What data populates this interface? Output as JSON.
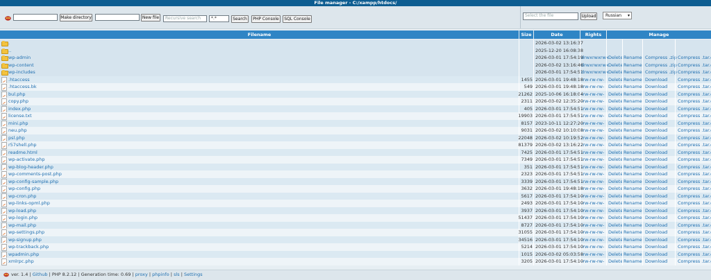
{
  "title": "File manager - C:/xampp/htdocs/",
  "toolbar": {
    "make_dir_value": "",
    "make_dir_label": "Make directory",
    "new_file_value": "",
    "new_file_label": "New file",
    "search_placeholder": "Recursive search",
    "mask_value": "*.*",
    "search_label": "Search",
    "php_console_label": "PHP Console",
    "sql_console_label": "SQL Console",
    "select_file_placeholder": "Select the file",
    "upload_label": "Upload",
    "language": "Russian"
  },
  "columns": {
    "filename": "Filename",
    "size": "Size",
    "date": "Date",
    "rights": "Rights",
    "manage": "Manage"
  },
  "rows": [
    {
      "type": "dir",
      "name": ".",
      "size": "",
      "date": "2026-03-02 13:16:37",
      "rights": "",
      "del": "",
      "ren": "",
      "dl": "",
      "cg": ""
    },
    {
      "type": "dir",
      "name": "..",
      "size": "",
      "date": "2025-12-20 16:08:38",
      "rights": "",
      "del": "",
      "ren": "",
      "dl": "",
      "cg": ""
    },
    {
      "type": "dir",
      "name": "wp-admin",
      "size": "",
      "date": "2026-03-01 17:54:19",
      "rights": "drwxrwxrwx",
      "del": "Delete",
      "ren": "Rename",
      "dl": "Compress .zip",
      "cg": "Compress .tar.gz"
    },
    {
      "type": "dir",
      "name": "wp-content",
      "size": "",
      "date": "2026-03-02 13:16:46",
      "rights": "drwxrwxrwx",
      "del": "Delete",
      "ren": "Rename",
      "dl": "Compress .zip",
      "cg": "Compress .tar.gz"
    },
    {
      "type": "dir",
      "name": "wp-includes",
      "size": "",
      "date": "2026-03-01 17:54:51",
      "rights": "drwxrwxrwx",
      "del": "Delete",
      "ren": "Rename",
      "dl": "Compress .zip",
      "cg": "Compress .tar.gz"
    },
    {
      "type": "file",
      "name": ".htaccess",
      "size": "1455",
      "date": "2026-03-01 19:48:18",
      "rights": "-rw-rw-rw-",
      "del": "Delete",
      "ren": "Rename",
      "dl": "Download",
      "cg": "Compress .tar.gz"
    },
    {
      "type": "file",
      "name": ".htaccess.bk",
      "size": "549",
      "date": "2026-03-01 19:48:18",
      "rights": "-rw-rw-rw-",
      "del": "Delete",
      "ren": "Rename",
      "dl": "Download",
      "cg": "Compress .tar.gz"
    },
    {
      "type": "file",
      "name": "bul.php",
      "size": "21262",
      "date": "2025-10-06 16:18:04",
      "rights": "-rw-rw-rw-",
      "del": "Delete",
      "ren": "Rename",
      "dl": "Download",
      "cg": "Compress .tar.gz"
    },
    {
      "type": "file",
      "name": "copy.php",
      "size": "2311",
      "date": "2026-03-02 12:35:20",
      "rights": "-rw-rw-rw-",
      "del": "Delete",
      "ren": "Rename",
      "dl": "Download",
      "cg": "Compress .tar.gz"
    },
    {
      "type": "file",
      "name": "index.php",
      "size": "405",
      "date": "2026-03-01 17:54:51",
      "rights": "-rw-rw-rw-",
      "del": "Delete",
      "ren": "Rename",
      "dl": "Download",
      "cg": "Compress .tar.gz"
    },
    {
      "type": "file",
      "name": "license.txt",
      "size": "19903",
      "date": "2026-03-01 17:54:51",
      "rights": "-rw-rw-rw-",
      "del": "Delete",
      "ren": "Rename",
      "dl": "Download",
      "cg": "Compress .tar.gz"
    },
    {
      "type": "file",
      "name": "mini.php",
      "size": "8157",
      "date": "2023-10-11 12:27:20",
      "rights": "-rw-rw-rw-",
      "del": "Delete",
      "ren": "Rename",
      "dl": "Download",
      "cg": "Compress .tar.gz"
    },
    {
      "type": "file",
      "name": "neu.php",
      "size": "9031",
      "date": "2026-03-02 10:10:08",
      "rights": "-rw-rw-rw-",
      "del": "Delete",
      "ren": "Rename",
      "dl": "Download",
      "cg": "Compress .tar.gz"
    },
    {
      "type": "file",
      "name": "psl.php",
      "size": "22048",
      "date": "2026-03-02 10:19:52",
      "rights": "-rw-rw-rw-",
      "del": "Delete",
      "ren": "Rename",
      "dl": "Download",
      "cg": "Compress .tar.gz"
    },
    {
      "type": "file",
      "name": "r57shell.php",
      "size": "81379",
      "date": "2026-03-02 13:16:22",
      "rights": "-rw-rw-rw-",
      "del": "Delete",
      "ren": "Rename",
      "dl": "Download",
      "cg": "Compress .tar.gz"
    },
    {
      "type": "file",
      "name": "readme.html",
      "size": "7425",
      "date": "2026-03-01 17:54:51",
      "rights": "-rw-rw-rw-",
      "del": "Delete",
      "ren": "Rename",
      "dl": "Download",
      "cg": "Compress .tar.gz"
    },
    {
      "type": "file",
      "name": "wp-activate.php",
      "size": "7349",
      "date": "2026-03-01 17:54:51",
      "rights": "-rw-rw-rw-",
      "del": "Delete",
      "ren": "Rename",
      "dl": "Download",
      "cg": "Compress .tar.gz"
    },
    {
      "type": "file",
      "name": "wp-blog-header.php",
      "size": "351",
      "date": "2026-03-01 17:54:51",
      "rights": "-rw-rw-rw-",
      "del": "Delete",
      "ren": "Rename",
      "dl": "Download",
      "cg": "Compress .tar.gz"
    },
    {
      "type": "file",
      "name": "wp-comments-post.php",
      "size": "2323",
      "date": "2026-03-01 17:54:51",
      "rights": "-rw-rw-rw-",
      "del": "Delete",
      "ren": "Rename",
      "dl": "Download",
      "cg": "Compress .tar.gz"
    },
    {
      "type": "file",
      "name": "wp-config-sample.php",
      "size": "3339",
      "date": "2026-03-01 17:54:51",
      "rights": "-rw-rw-rw-",
      "del": "Delete",
      "ren": "Rename",
      "dl": "Download",
      "cg": "Compress .tar.gz"
    },
    {
      "type": "file",
      "name": "wp-config.php",
      "size": "3632",
      "date": "2026-03-01 19:48:18",
      "rights": "-rw-rw-rw-",
      "del": "Delete",
      "ren": "Rename",
      "dl": "Download",
      "cg": "Compress .tar.gz"
    },
    {
      "type": "file",
      "name": "wp-cron.php",
      "size": "5617",
      "date": "2026-03-01 17:54:10",
      "rights": "-rw-rw-rw-",
      "del": "Delete",
      "ren": "Rename",
      "dl": "Download",
      "cg": "Compress .tar.gz"
    },
    {
      "type": "file",
      "name": "wp-links-opml.php",
      "size": "2493",
      "date": "2026-03-01 17:54:10",
      "rights": "-rw-rw-rw-",
      "del": "Delete",
      "ren": "Rename",
      "dl": "Download",
      "cg": "Compress .tar.gz"
    },
    {
      "type": "file",
      "name": "wp-load.php",
      "size": "3937",
      "date": "2026-03-01 17:54:10",
      "rights": "-rw-rw-rw-",
      "del": "Delete",
      "ren": "Rename",
      "dl": "Download",
      "cg": "Compress .tar.gz"
    },
    {
      "type": "file",
      "name": "wp-login.php",
      "size": "51437",
      "date": "2026-03-01 17:54:10",
      "rights": "-rw-rw-rw-",
      "del": "Delete",
      "ren": "Rename",
      "dl": "Download",
      "cg": "Compress .tar.gz"
    },
    {
      "type": "file",
      "name": "wp-mail.php",
      "size": "8727",
      "date": "2026-03-01 17:54:10",
      "rights": "-rw-rw-rw-",
      "del": "Delete",
      "ren": "Rename",
      "dl": "Download",
      "cg": "Compress .tar.gz"
    },
    {
      "type": "file",
      "name": "wp-settings.php",
      "size": "31055",
      "date": "2026-03-01 17:54:10",
      "rights": "-rw-rw-rw-",
      "del": "Delete",
      "ren": "Rename",
      "dl": "Download",
      "cg": "Compress .tar.gz"
    },
    {
      "type": "file",
      "name": "wp-signup.php",
      "size": "34516",
      "date": "2026-03-01 17:54:10",
      "rights": "-rw-rw-rw-",
      "del": "Delete",
      "ren": "Rename",
      "dl": "Download",
      "cg": "Compress .tar.gz"
    },
    {
      "type": "file",
      "name": "wp-trackback.php",
      "size": "5214",
      "date": "2026-03-01 17:54:10",
      "rights": "-rw-rw-rw-",
      "del": "Delete",
      "ren": "Rename",
      "dl": "Download",
      "cg": "Compress .tar.gz"
    },
    {
      "type": "file",
      "name": "wpadmin.php",
      "size": "1015",
      "date": "2026-03-02 05:03:58",
      "rights": "-rw-rw-rw-",
      "del": "Delete",
      "ren": "Rename",
      "dl": "Download",
      "cg": "Compress .tar.gz"
    },
    {
      "type": "file",
      "name": "xmlrpc.php",
      "size": "3205",
      "date": "2026-03-01 17:54:10",
      "rights": "-rw-rw-rw-",
      "del": "Delete",
      "ren": "Rename",
      "dl": "Download",
      "cg": "Compress .tar.gz"
    }
  ],
  "footer": {
    "version": "ver. 1.4",
    "sep1": " | ",
    "github": "Github",
    "sep2": " | ",
    "php": "PHP 8.2.12",
    "sep3": " | ",
    "gen": "Generation time: 0.69",
    "sep4": " | ",
    "proxy": "proxy",
    "sep5": " | ",
    "phpinfo": "phpinfo",
    "sep6": " | ",
    "sls": "sls",
    "sep7": " | ",
    "settings": "Settings"
  },
  "colors": {
    "title_bg": "#0d5d91",
    "header_bg": "#2f85c5",
    "link": "#1f6fb0",
    "row_odd": "#dbe9f2",
    "row_even": "#eef4f8"
  },
  "icons": {
    "logo": "shell-logo-icon",
    "folder": "folder-icon",
    "file": "php-file-icon"
  }
}
